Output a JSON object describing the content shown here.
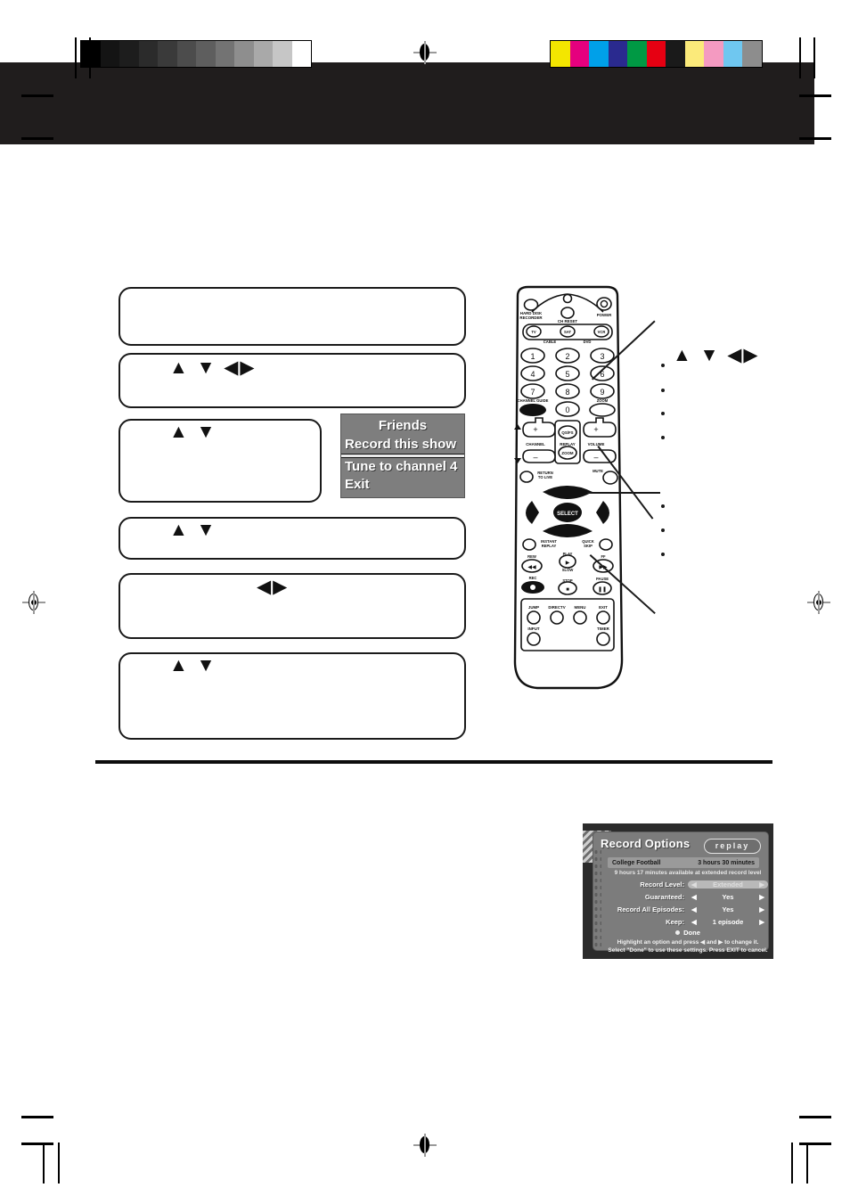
{
  "page": {
    "divider": "rule",
    "black_band": "header-band"
  },
  "calibration": {
    "grayscale_swatches": [
      "#000000",
      "#141414",
      "#1d1d1d",
      "#2b2b2b",
      "#3a3a3a",
      "#4c4c4c",
      "#5e5e5e",
      "#737373",
      "#8e8e8e",
      "#a9a9a9",
      "#c6c6c6",
      "#ffffff"
    ],
    "color_swatches": [
      "#f3e600",
      "#e5007e",
      "#00a0e9",
      "#2a2a8f",
      "#009944",
      "#e60012",
      "#1a1a1a",
      "#fbea7a",
      "#f49ac1",
      "#6fc7f0",
      "#8d8d8d"
    ]
  },
  "steps": [
    {
      "id": "step-1",
      "arrows": ""
    },
    {
      "id": "step-2",
      "arrows": "▲ ▼ ◀▶"
    },
    {
      "id": "step-3",
      "arrows": "▲ ▼"
    },
    {
      "id": "step-4",
      "arrows": "▲ ▼"
    },
    {
      "id": "step-5",
      "arrows": "◀▶"
    },
    {
      "id": "step-6",
      "arrows": "▲ ▼"
    }
  ],
  "popup_menu": {
    "title": "Friends",
    "items": [
      {
        "label": "Record this show",
        "selected": false
      },
      {
        "label": "",
        "selected": true
      },
      {
        "label": "Tune to channel 4",
        "selected": false
      },
      {
        "label": "Exit",
        "selected": false
      }
    ]
  },
  "callouts": {
    "arrows_label": "▲ ▼ ◀▶",
    "group_one_bullets": [
      "",
      "",
      "",
      ""
    ],
    "group_two_bullets": [
      "",
      "",
      ""
    ]
  },
  "remote": {
    "buttons": {
      "hard_disk_recorder": "HARD DISK RECORDER",
      "ch_reset": "CH RESET",
      "power": "POWER",
      "device_tv": "TV",
      "device_cable": "CABLE",
      "device_sat": "SAT",
      "device_dvd": "DVD",
      "device_vcr": "VCR",
      "numbers": [
        "1",
        "2",
        "3",
        "4",
        "5",
        "6",
        "7",
        "8",
        "9",
        "0"
      ],
      "channel_label": "CHANNEL",
      "replay_label": "REPLAY",
      "volume_label": "VOLUME",
      "quickskip": "QS/FS",
      "zoom": "ZOOM",
      "mute": "MUTE",
      "return_to_live": "RETURN TO LIVE",
      "select": "SELECT",
      "instant_replay": "INSTANT REPLAY",
      "quick_skip": "QUICK SKIP",
      "rew": "REW",
      "play_slow": "PLAY SLOW",
      "ff": "FF",
      "rec": "REC",
      "stop": "STOP",
      "pause": "PAUSE",
      "jump": "JUMP",
      "directv": "DIRECTV",
      "menu": "MENU",
      "exit": "EXIT",
      "input": "INPUT",
      "timer": "TIMER",
      "channel_guide": "CHANNEL GUIDE"
    }
  },
  "tv_screen": {
    "title": "Record Options",
    "brand_logo": "replay",
    "program_title": "College Football",
    "program_duration": "3 hours 30 minutes",
    "availability": "9 hours 17 minutes available at extended record level",
    "options": [
      {
        "label": "Record Level:",
        "value": "Extended",
        "highlighted": true
      },
      {
        "label": "Guaranteed:",
        "value": "Yes",
        "highlighted": false
      },
      {
        "label": "Record All Episodes:",
        "value": "Yes",
        "highlighted": false
      },
      {
        "label": "Keep:",
        "value": "1 episode",
        "highlighted": false
      }
    ],
    "done_label": "Done",
    "hint_line1": "Highlight an option and press ◀ and ▶ to change it.",
    "hint_line2": "Select \"Done\" to use these settings. Press EXIT to cancel."
  }
}
